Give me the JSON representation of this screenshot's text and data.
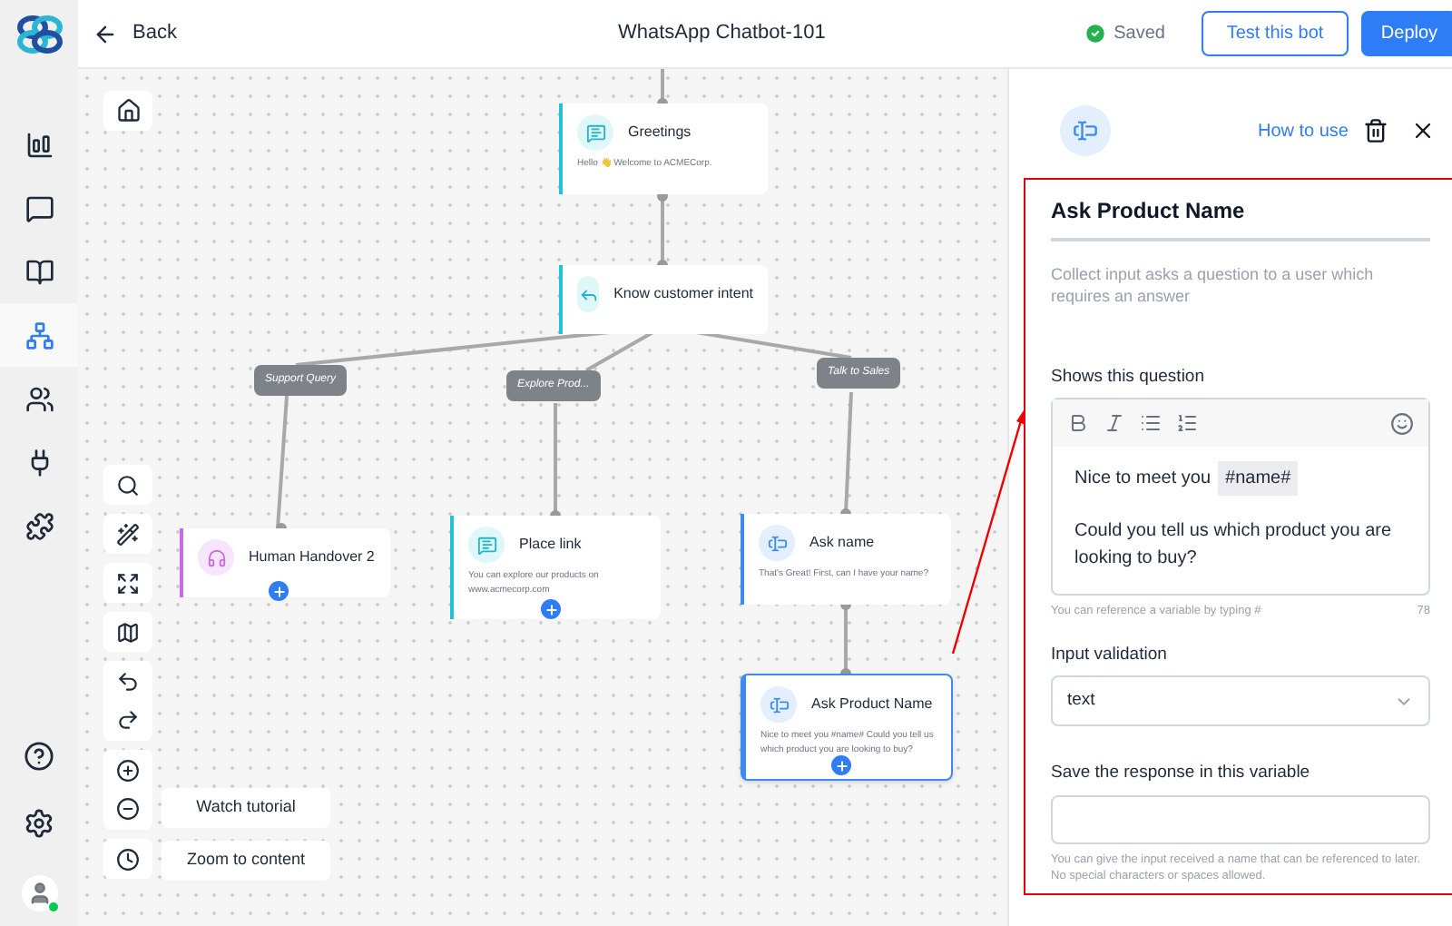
{
  "header": {
    "back": "Back",
    "title": "WhatsApp Chatbot-101",
    "status": "Saved",
    "test_button": "Test this bot",
    "deploy_button": "Deploy"
  },
  "sidebar": {
    "items": [
      {
        "kind": "analytics",
        "selected": false
      },
      {
        "kind": "chat",
        "selected": false
      },
      {
        "kind": "book",
        "selected": false
      },
      {
        "kind": "flow",
        "selected": true
      },
      {
        "kind": "users",
        "selected": false
      },
      {
        "kind": "plug",
        "selected": false
      },
      {
        "kind": "puzzle",
        "selected": false
      }
    ]
  },
  "canvas": {
    "nodes": [
      {
        "kind": "message",
        "title": "Greetings",
        "text": "Hello 👋 Welcome to ACMECorp.",
        "color": "#22c3d6",
        "selected": false
      },
      {
        "kind": "intent",
        "title": "Know customer intent",
        "color": "#22c3d6",
        "selected": false
      },
      {
        "kind": "handover",
        "title": "Human Handover 2",
        "color": "#c86be0",
        "selected": false
      },
      {
        "kind": "message",
        "title": "Place link",
        "text": "You can explore our products on www.acmecorp.com",
        "color": "#22c3d6",
        "selected": false
      },
      {
        "kind": "input",
        "title": "Ask name",
        "text": "That's Great! First, can I have your name?",
        "color": "#3b8bf0",
        "selected": false
      },
      {
        "kind": "input",
        "title": "Ask Product Name",
        "text": "Nice to meet you #name# Could you tell us which product you are looking to buy?",
        "color": "#3b8bf0",
        "selected": true
      }
    ],
    "branches": [
      {
        "label": "Support Query"
      },
      {
        "label": "Explore Prod..."
      },
      {
        "label": "Talk to Sales"
      }
    ],
    "watch_tutorial": "Watch tutorial",
    "zoom_to_content": "Zoom to content"
  },
  "panel": {
    "how_to_use": "How to use",
    "name": "Ask Product Name",
    "description": "Collect input asks a question to a user which requires an answer",
    "question_label": "Shows this question",
    "message_before": "Nice to meet you",
    "variable": "#name#",
    "message_after": "Could you tell us which product you are looking to buy?",
    "question_hint": "You can reference a variable by typing #",
    "char_count": "78",
    "validation_label": "Input validation",
    "validation_value": "text",
    "save_label": "Save the response in this variable",
    "save_hint": "You can give the input received a name that can be referenced to later. No special characters or spaces allowed."
  }
}
